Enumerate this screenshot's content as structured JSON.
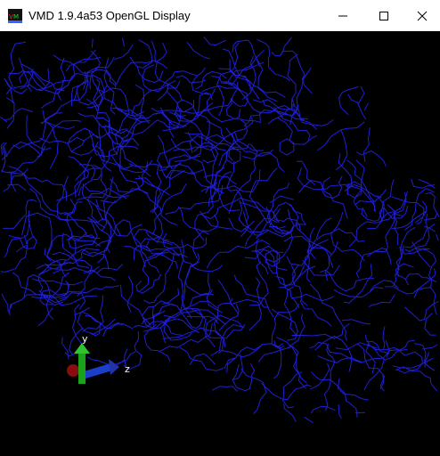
{
  "window": {
    "title": "VMD 1.9.4a53 OpenGL Display",
    "app_icon": "vmd-app-icon",
    "controls": [
      "minimize-icon",
      "maximize-icon",
      "close-icon"
    ]
  },
  "display": {
    "background": "#000000",
    "representation_color": "#1f1fd6",
    "axes": {
      "x_label": "",
      "y_label": "y",
      "z_label": "z",
      "x_color": "#b01010",
      "y_color": "#1aa31a",
      "z_color": "#1a3fc8"
    }
  }
}
